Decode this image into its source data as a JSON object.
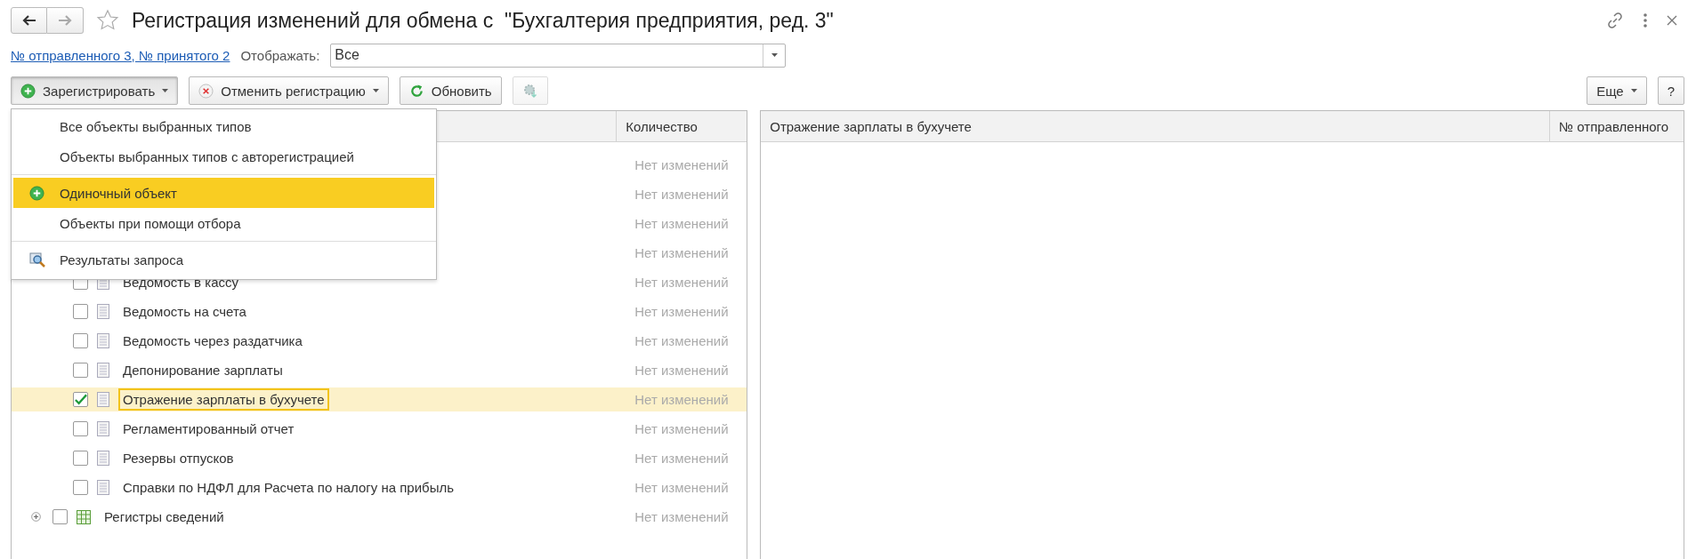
{
  "window": {
    "title": "Регистрация изменений для обмена с  \"Бухгалтерия предприятия, ред. 3\"",
    "nav": [
      {
        "kind": "back",
        "disabled": false
      },
      {
        "kind": "forward",
        "disabled": true
      }
    ]
  },
  "summary_link": "№ отправленного 3, № принятого 2",
  "filter": {
    "label": "Отображать:",
    "value": "Все"
  },
  "toolbar": {
    "buttons": [
      {
        "label": "Зарегистрировать",
        "kind": "add",
        "dropdown": true,
        "pressed": true,
        "disabled": false
      },
      {
        "label": "Отменить регистрацию",
        "kind": "cancel",
        "dropdown": true,
        "pressed": false,
        "disabled": false
      },
      {
        "label": "Обновить",
        "kind": "refresh",
        "dropdown": false,
        "pressed": false,
        "disabled": false
      },
      {
        "kind": "export",
        "dropdown": false,
        "pressed": false,
        "disabled": true
      }
    ],
    "right": [
      {
        "label": "Еще",
        "dropdown": true
      },
      {
        "label": "?",
        "dropdown": false
      }
    ]
  },
  "menu": {
    "groups": [
      {
        "items": [
          {
            "label": "Все объекты выбранных типов",
            "kind": "plain",
            "selected": false
          },
          {
            "label": "Объекты выбранных типов с авторегистрацией",
            "kind": "plain",
            "selected": false
          }
        ]
      },
      {
        "items": [
          {
            "label": "Одиночный объект",
            "kind": "add",
            "selected": true
          },
          {
            "label": "Объекты при помощи отбора",
            "kind": "plain",
            "selected": false
          }
        ]
      },
      {
        "items": [
          {
            "label": "Результаты запроса",
            "kind": "query",
            "selected": false
          }
        ]
      }
    ]
  },
  "tree": {
    "count_column": "Количество",
    "rows": [
      {
        "count": "Нет изменений",
        "children": [
          {
            "count": "Нет изменений",
            "children": [
              {
                "count": "Нет изменений"
              },
              {
                "count": "Нет изменений"
              },
              {
                "label": "Ведомость в кассу",
                "kind": "document",
                "checked": false,
                "selected": false,
                "count": "Нет изменений"
              },
              {
                "label": "Ведомость на счета",
                "kind": "document",
                "checked": false,
                "selected": false,
                "count": "Нет изменений"
              },
              {
                "label": "Ведомость через раздатчика",
                "kind": "document",
                "checked": false,
                "selected": false,
                "count": "Нет изменений"
              },
              {
                "label": "Депонирование зарплаты",
                "kind": "document",
                "checked": false,
                "selected": false,
                "count": "Нет изменений"
              },
              {
                "label": "Отражение зарплаты в бухучете",
                "kind": "document",
                "checked": true,
                "selected": true,
                "count": "Нет изменений"
              },
              {
                "label": "Регламентированный отчет",
                "kind": "document",
                "checked": false,
                "selected": false,
                "count": "Нет изменений"
              },
              {
                "label": "Резервы отпусков",
                "kind": "document",
                "checked": false,
                "selected": false,
                "count": "Нет изменений"
              },
              {
                "label": "Справки по НДФЛ для Расчета по налогу на прибыль",
                "kind": "document",
                "checked": false,
                "selected": false,
                "count": "Нет изменений"
              }
            ]
          },
          {
            "label": "Регистры сведений",
            "kind": "register",
            "checked": false,
            "selected": false,
            "expanded": false,
            "count": "Нет изменений"
          }
        ]
      }
    ]
  },
  "detail": {
    "columns": [
      "Отражение зарплаты в бухучете",
      "№ отправленного"
    ]
  }
}
